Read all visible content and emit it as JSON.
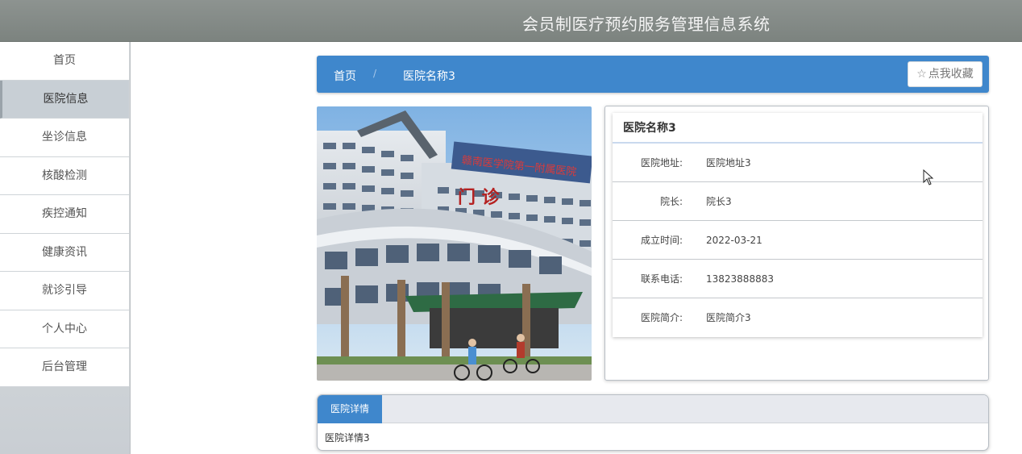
{
  "header": {
    "title": "会员制医疗预约服务管理信息系统"
  },
  "sidebar": {
    "items": [
      {
        "label": "首页",
        "icon": ""
      },
      {
        "label": "医院信息",
        "active": true
      },
      {
        "label": "坐诊信息"
      },
      {
        "label": "核酸检测"
      },
      {
        "label": "疾控通知"
      },
      {
        "label": "健康资讯"
      },
      {
        "label": "就诊引导"
      },
      {
        "label": "个人中心"
      },
      {
        "label": "后台管理"
      }
    ]
  },
  "breadcrumb": {
    "home": "首页",
    "separator": "/",
    "current": "医院名称3"
  },
  "favorite_button": {
    "icon": "star-outline-icon",
    "star_glyph": "☆",
    "label": "点我收藏"
  },
  "photo": {
    "wall_text": "赣南医学院第一附属医院",
    "door_text": "门 诊"
  },
  "hospital": {
    "name": "医院名称3",
    "fields": [
      {
        "label": "医院地址:",
        "value": "医院地址3"
      },
      {
        "label": "院长:",
        "value": "院长3"
      },
      {
        "label": "成立时间:",
        "value": "2022-03-21"
      },
      {
        "label": "联系电话:",
        "value": "13823888883"
      },
      {
        "label": "医院简介:",
        "value": "医院简介3"
      }
    ]
  },
  "detail": {
    "tab_label": "医院详情",
    "content": "医院详情3"
  },
  "colors": {
    "accent": "#3f87cc",
    "topbar": "#858b88",
    "sidebar_active": "#c8cfd5"
  }
}
